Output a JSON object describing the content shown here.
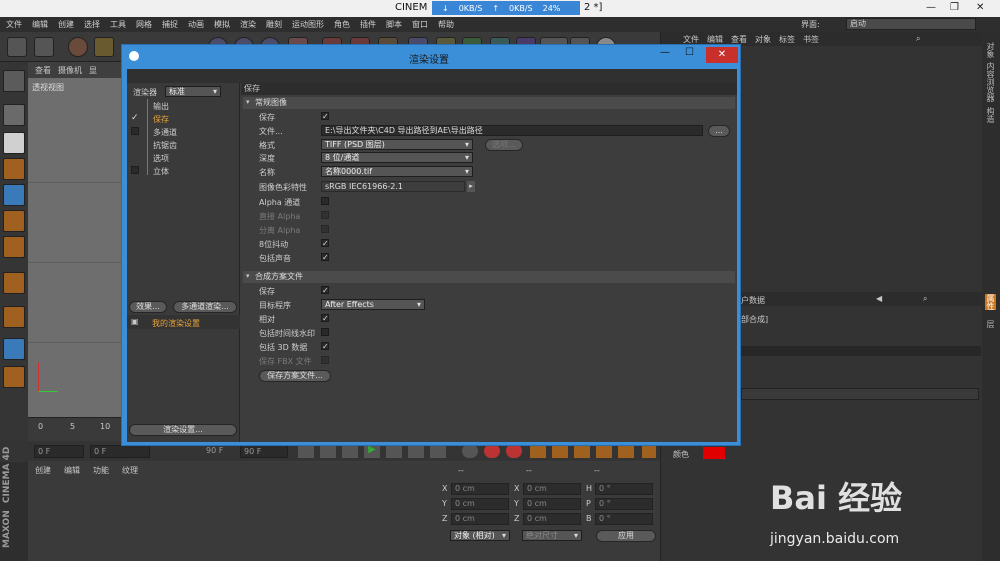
{
  "window": {
    "title": "CINEM",
    "title_suffix": "2 *]",
    "net_down": "0KB/S",
    "net_up": "0KB/S",
    "net_pct": "24%",
    "interface_label": "界面:",
    "interface_value": "启动"
  },
  "menubar": [
    "文件",
    "编辑",
    "创建",
    "选择",
    "工具",
    "网格",
    "捕捉",
    "动画",
    "模拟",
    "渲染",
    "雕刻",
    "运动图形",
    "角色",
    "插件",
    "脚本",
    "窗口",
    "帮助"
  ],
  "viewport": {
    "menu": [
      "查看",
      "摄像机",
      "显"
    ],
    "label": "透视视图"
  },
  "timeline": {
    "ticks": [
      "0",
      "5",
      "10"
    ],
    "frame_start": "0 F",
    "frame_mid": "0 F",
    "frame_right": "90 F",
    "frame_end": "90 F"
  },
  "materials": {
    "menu": [
      "创建",
      "编辑",
      "功能",
      "纹理"
    ],
    "brand_line1": "MAXON",
    "brand_line2": "CINEMA 4D"
  },
  "coords": {
    "headers": [
      "--",
      "--",
      "--"
    ],
    "rows": [
      {
        "a": "X",
        "av": "0 cm",
        "b": "X",
        "bv": "0 cm",
        "c": "H",
        "cv": "0 °"
      },
      {
        "a": "Y",
        "av": "0 cm",
        "b": "Y",
        "bv": "0 cm",
        "c": "P",
        "cv": "0 °"
      },
      {
        "a": "Z",
        "av": "0 cm",
        "b": "Z",
        "bv": "0 cm",
        "c": "B",
        "cv": "0 °"
      }
    ],
    "mode": "对象 (相对)",
    "size_mode": "绝对尺寸",
    "apply": "应用"
  },
  "rightpanel": {
    "menu": [
      "文件",
      "编辑",
      "查看",
      "对象",
      "标签",
      "书签"
    ],
    "attr_label": "户数据",
    "attr_sub": "部合成]",
    "color_label": "颜色",
    "color_value": "#e00000",
    "vtabs": [
      "对象",
      "内容浏览器",
      "构造"
    ],
    "vtabs2": [
      "属性",
      "层"
    ]
  },
  "dialog": {
    "title": "渲染设置",
    "renderer_label": "渲染器",
    "renderer_value": "标准",
    "nav": [
      {
        "label": "输出",
        "active": false,
        "checked": false,
        "box": false
      },
      {
        "label": "保存",
        "active": true,
        "checked": true,
        "box": false
      },
      {
        "label": "多通道",
        "active": false,
        "checked": false,
        "box": true
      },
      {
        "label": "抗锯齿",
        "active": false,
        "checked": false,
        "box": false
      },
      {
        "label": "选项",
        "active": false,
        "checked": false,
        "box": false
      },
      {
        "label": "立体",
        "active": false,
        "checked": false,
        "box": true
      }
    ],
    "btn_effects": "效果...",
    "btn_multipass": "多通道渲染...",
    "preset_name": "我的渲染设置",
    "btn_render_settings": "渲染设置...",
    "header": "保存",
    "section_regular": "常规图像",
    "regular": {
      "save_label": "保存",
      "file_label": "文件...",
      "file_value": "E:\\导出文件夹\\C4D 导出路径到AE\\导出路径",
      "file_btn": "...",
      "format_label": "格式",
      "format_value": "TIFF (PSD 图层)",
      "options_btn": "选项...",
      "depth_label": "深度",
      "depth_value": "8 位/通道",
      "name_label": "名称",
      "name_value": "名称0000.tif",
      "profile_label": "图像色彩特性",
      "profile_value": "sRGB IEC61966-2.1",
      "alpha_label": "Alpha 通道",
      "straight_label": "直接 Alpha",
      "separate_label": "分离 Alpha",
      "dither_label": "8位抖动",
      "sound_label": "包括声音"
    },
    "section_comp": "合成方案文件",
    "comp": {
      "save_label": "保存",
      "target_label": "目标程序",
      "target_value": "After Effects",
      "relative_label": "相对",
      "timeline_label": "包括时间线水印",
      "data3d_label": "包括 3D 数据",
      "fbx_label": "保存 FBX 文件",
      "save_btn": "保存方案文件..."
    }
  },
  "watermark": {
    "logo": "Bai 经验",
    "url": "jingyan.baidu.com"
  }
}
